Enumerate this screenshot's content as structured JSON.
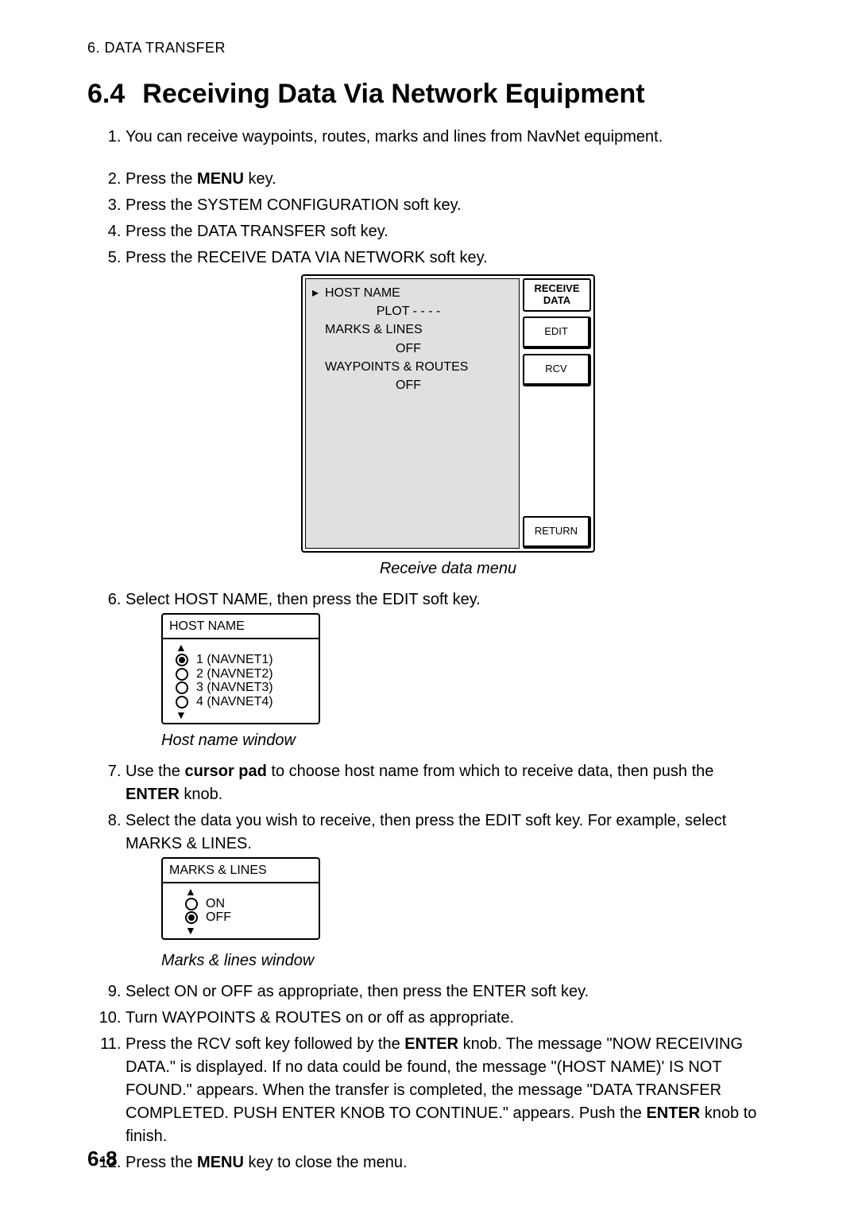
{
  "running_head": "6.  DATA  TRANSFER",
  "section": {
    "number": "6.4",
    "title": "Receiving Data Via Network Equipment"
  },
  "steps": {
    "s1": "You can receive waypoints, routes, marks and lines from NavNet equipment.",
    "s2_a": "Press the ",
    "s2_b": "MENU",
    "s2_c": " key.",
    "s3": "Press the SYSTEM CONFIGURATION soft key.",
    "s4": "Press the DATA TRANSFER soft key.",
    "s5": "Press the RECEIVE DATA VIA NETWORK soft key.",
    "s6": "Select HOST NAME, then press the EDIT soft key.",
    "s7_a": "Use the ",
    "s7_b": "cursor pad",
    "s7_c": " to choose host name from which to receive data, then push the ",
    "s7_d": "ENTER",
    "s7_e": " knob.",
    "s8": "Select the data you wish to receive, then press the EDIT soft key. For example, select MARKS & LINES.",
    "s9": "Select ON or OFF as appropriate, then press the ENTER soft key.",
    "s10": "Turn WAYPOINTS & ROUTES on or off as appropriate.",
    "s11_a": "Press the RCV soft key followed by the ",
    "s11_b": "ENTER",
    "s11_c": " knob. The message \"NOW RECEIVING DATA.\" is displayed. If no data could be found, the message \"(HOST NAME)' IS NOT FOUND.\" appears. When the transfer is completed, the message \"DATA TRANSFER COMPLETED. PUSH ENTER KNOB TO CONTINUE.\" appears. Push the ",
    "s11_d": "ENTER",
    "s11_e": " knob to finish.",
    "s12_a": "Press the ",
    "s12_b": "MENU",
    "s12_c": " key to close the menu."
  },
  "fig_receive": {
    "menu": {
      "host": "HOST NAME",
      "host_val": "PLOT - - - -",
      "marks": "MARKS & LINES",
      "marks_val": "OFF",
      "wpts": "WAYPOINTS & ROUTES",
      "wpts_val": "OFF"
    },
    "softkeys": {
      "title": "RECEIVE DATA",
      "edit": "EDIT",
      "rcv": "RCV",
      "return": "RETURN"
    },
    "caption": "Receive data menu"
  },
  "fig_host": {
    "title": "HOST NAME",
    "opts": [
      "1 (NAVNET1)",
      "2 (NAVNET2)",
      "3 (NAVNET3)",
      "4 (NAVNET4)"
    ],
    "selected": 0,
    "caption": "Host name window"
  },
  "fig_marks": {
    "title": "MARKS & LINES",
    "opts": [
      "ON",
      "OFF"
    ],
    "selected": 1,
    "caption": "Marks & lines window"
  },
  "page_number": "6-8"
}
